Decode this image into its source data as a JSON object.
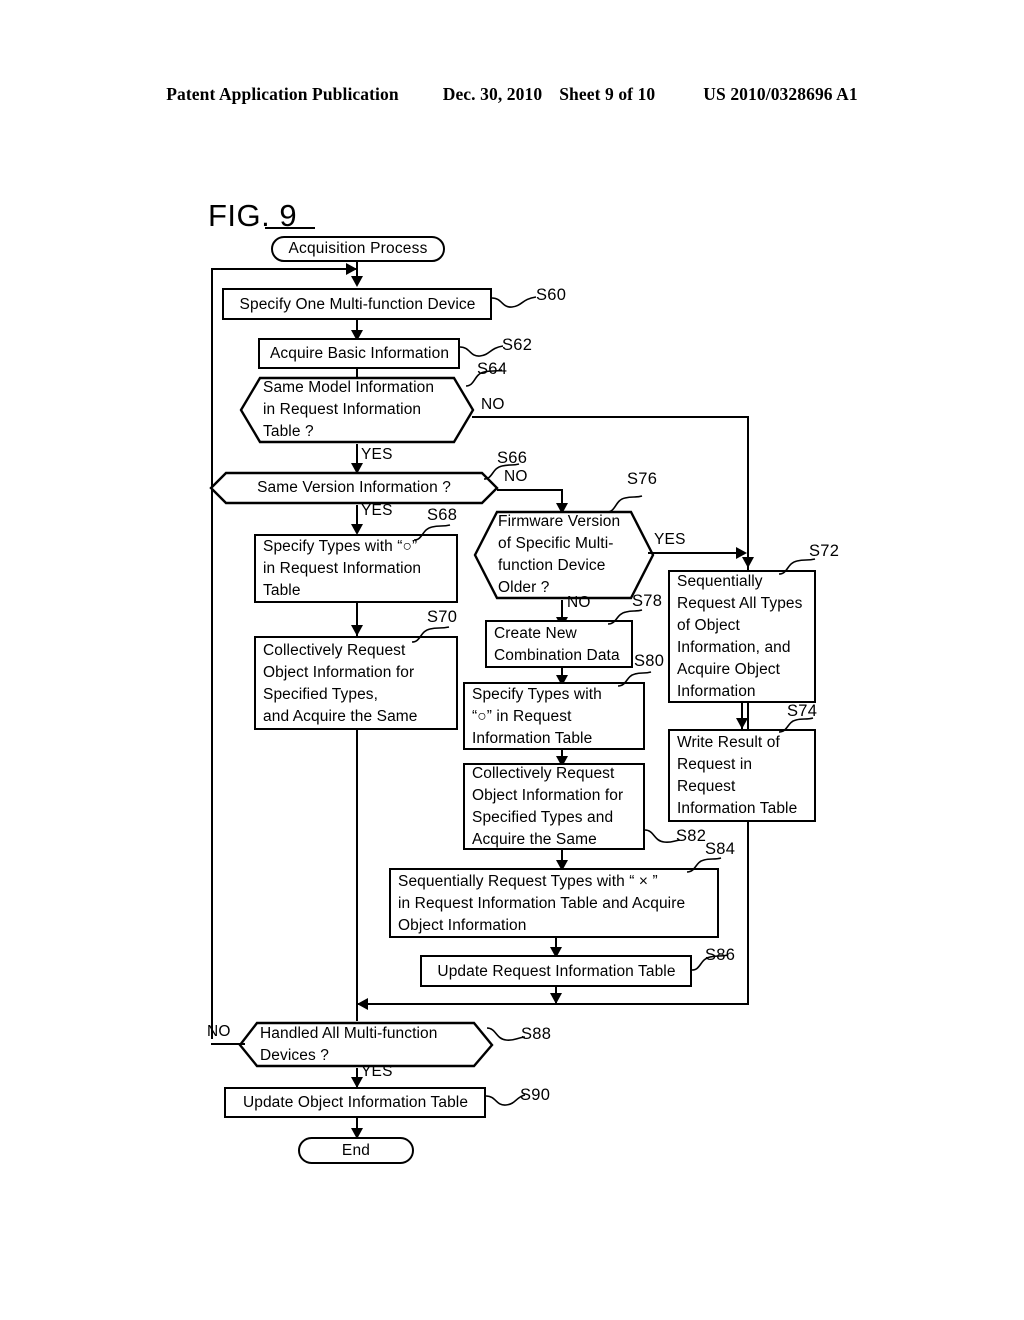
{
  "header": {
    "left": "Patent Application Publication",
    "date": "Dec. 30, 2010",
    "sheet": "Sheet 9 of 10",
    "pubnum": "US 2010/0328696 A1"
  },
  "figure": {
    "title": "FIG. 9"
  },
  "nodes": {
    "start": {
      "label": "Acquisition Process"
    },
    "s60": {
      "ref": "S60",
      "text": "Specify One Multi-function Device"
    },
    "s62": {
      "ref": "S62",
      "text": "Acquire Basic Information"
    },
    "s64": {
      "ref": "S64",
      "line1": "Same Model Information",
      "line2": "in Request Information",
      "line3": "Table ?"
    },
    "s66": {
      "ref": "S66",
      "text": "Same Version Information ?"
    },
    "s68": {
      "ref": "S68",
      "line1": "Specify Types with “○”",
      "line2": "in Request Information",
      "line3": "Table"
    },
    "s70": {
      "ref": "S70",
      "line1": "Collectively Request",
      "line2": "Object Information for",
      "line3": "Specified Types,",
      "line4": "and Acquire the Same"
    },
    "s72": {
      "ref": "S72",
      "line1": "Sequentially",
      "line2": "Request All Types",
      "line3": "of Object",
      "line4": "Information, and",
      "line5": "Acquire Object",
      "line6": "Information"
    },
    "s74": {
      "ref": "S74",
      "line1": "Write Result of",
      "line2": "Request in",
      "line3": "Request",
      "line4": "Information Table"
    },
    "s76": {
      "ref": "S76",
      "line1": "Firmware Version",
      "line2": "of Specific Multi-",
      "line3": "function Device",
      "line4": "Older ?"
    },
    "s78": {
      "ref": "S78",
      "line1": "Create New",
      "line2": "Combination Data"
    },
    "s80": {
      "ref": "S80",
      "line1": "Specify Types with",
      "line2": "“○” in Request",
      "line3": "Information Table"
    },
    "s82": {
      "ref": "S82",
      "line1": "Collectively Request",
      "line2": "Object Information for",
      "line3": "Specified Types and",
      "line4": "Acquire the Same"
    },
    "s84": {
      "ref": "S84",
      "line1": "Sequentially Request Types with “ × ”",
      "line2": "in Request Information Table and Acquire",
      "line3": "Object Information"
    },
    "s86": {
      "ref": "S86",
      "text": "Update Request Information Table"
    },
    "s88": {
      "ref": "S88",
      "line1": "Handled All Multi-function",
      "line2": "Devices ?"
    },
    "s90": {
      "ref": "S90",
      "text": "Update Object Information Table"
    },
    "end": {
      "label": "End"
    }
  },
  "branch_labels": {
    "s64_no": "NO",
    "s64_yes": "YES",
    "s66_no": "NO",
    "s66_yes": "YES",
    "s76_yes": "YES",
    "s76_no": "NO",
    "s88_no": "NO",
    "s88_yes": "YES"
  }
}
